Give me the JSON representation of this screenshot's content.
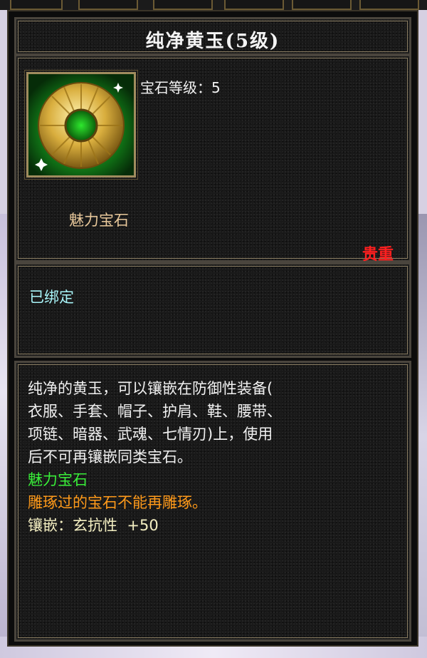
{
  "item": {
    "name": "纯净黄玉(5级)",
    "level_label": "宝石等级：",
    "level_value": "5",
    "category": "魅力宝石",
    "rarity": "贵重",
    "rarity_color": "#ff1f1f",
    "bind_status": "已绑定",
    "icon": "jade-disc-icon"
  },
  "description": {
    "lines": [
      "纯净的黄玉，可以镶嵌在防御性装备(",
      "衣服、手套、帽子、护肩、鞋、腰带、",
      "项链、暗器、武魂、七情刃)上，使用",
      "后不可再镶嵌同类宝石。"
    ],
    "gem_type": "魅力宝石",
    "gem_type_color": "#39ee39",
    "carve_note": "雕琢过的宝石不能再雕琢。",
    "carve_note_color": "#ff9a1a",
    "inlay_label": "镶嵌：",
    "inlay_stat": "玄抗性",
    "inlay_value": "+50"
  }
}
